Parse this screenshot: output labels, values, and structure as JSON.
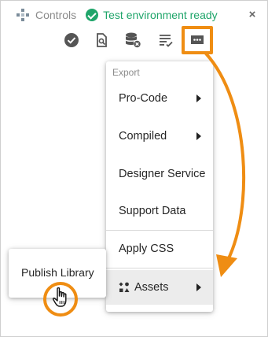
{
  "header": {
    "title": "Controls",
    "status": "Test environment ready",
    "close": "×"
  },
  "toolbar": {
    "icons": [
      "check-circle-icon",
      "document-search-icon",
      "database-delete-icon",
      "list-check-icon",
      "dots-message-icon"
    ]
  },
  "menu": {
    "header": "Export",
    "items": [
      {
        "label": "Pro-Code",
        "submenu": true
      },
      {
        "label": "Compiled",
        "submenu": true
      },
      {
        "label": "Designer Service",
        "submenu": false
      },
      {
        "label": "Support Data",
        "submenu": false
      },
      {
        "label": "Apply CSS",
        "submenu": false
      },
      {
        "label": "Assets",
        "submenu": true
      }
    ]
  },
  "submenu": {
    "items": [
      {
        "label": "Publish Library"
      }
    ]
  },
  "colors": {
    "accent": "#ef8d13",
    "status": "#1fa56a"
  }
}
